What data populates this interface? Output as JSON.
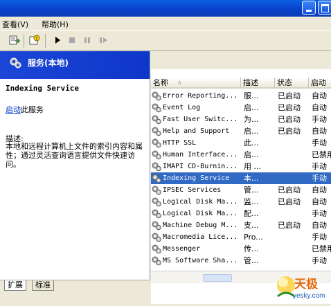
{
  "menu": [
    "查看(V)",
    "帮助(H)"
  ],
  "left": {
    "header_title": "服务(本地)",
    "service_name": "Indexing Service",
    "start_link": "启动",
    "start_suffix": "此服务",
    "desc_label": "描述:",
    "desc_text": "本地和远程计算机上文件的索引内容和属性；通过灵活查询语言提供文件快速访问。"
  },
  "tabs": [
    "扩展",
    "标准"
  ],
  "columns": [
    "名称",
    "描述",
    "状态",
    "启动"
  ],
  "services": [
    {
      "name": "Error Reporting...",
      "desc": "服...",
      "status": "已启动",
      "start": "自动"
    },
    {
      "name": "Event Log",
      "desc": "启...",
      "status": "已启动",
      "start": "自动"
    },
    {
      "name": "Fast User Switc...",
      "desc": "为...",
      "status": "已启动",
      "start": "手动"
    },
    {
      "name": "Help and Support",
      "desc": "启...",
      "status": "已启动",
      "start": "自动"
    },
    {
      "name": "HTTP SSL",
      "desc": "此...",
      "status": "",
      "start": "手动"
    },
    {
      "name": "Human Interface...",
      "desc": "启...",
      "status": "",
      "start": "已禁用"
    },
    {
      "name": "IMAPI CD-Burnin...",
      "desc": "用 ...",
      "status": "",
      "start": "手动"
    },
    {
      "name": "Indexing Service",
      "desc": "本...",
      "status": "",
      "start": "手动"
    },
    {
      "name": "IPSEC Services",
      "desc": "管...",
      "status": "已启动",
      "start": "自动"
    },
    {
      "name": "Logical Disk Ma...",
      "desc": "监...",
      "status": "已启动",
      "start": "自动"
    },
    {
      "name": "Logical Disk Ma...",
      "desc": "配...",
      "status": "",
      "start": "手动"
    },
    {
      "name": "Machine Debug M...",
      "desc": "支...",
      "status": "已启动",
      "start": "自动"
    },
    {
      "name": "Macromedia Lice...",
      "desc": "Pro...",
      "status": "",
      "start": "手动"
    },
    {
      "name": "Messenger",
      "desc": "传...",
      "status": "",
      "start": "已禁用"
    },
    {
      "name": "MS Software Sha...",
      "desc": "管...",
      "status": "",
      "start": "手动"
    }
  ],
  "selected_index": 7,
  "watermark": {
    "brand": "天极",
    "site": "yesky.com"
  },
  "colors": {
    "selection": "#316ac5",
    "header_blue": "#0e37c9"
  }
}
